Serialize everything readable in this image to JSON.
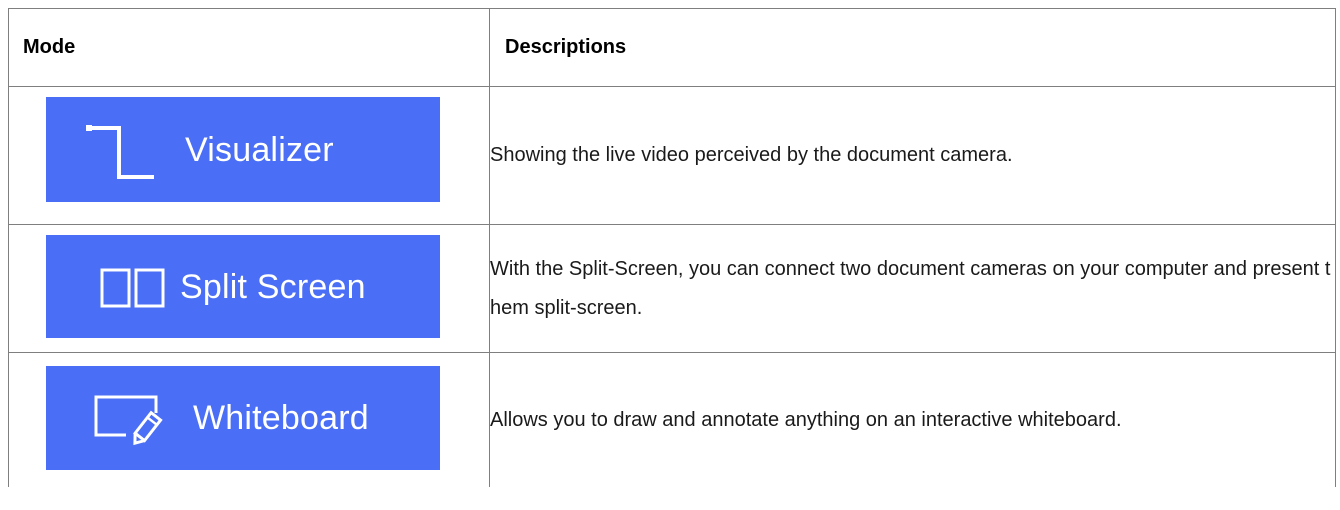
{
  "table": {
    "headers": {
      "mode": "Mode",
      "descriptions": "Descriptions"
    },
    "rows": [
      {
        "mode_label": "Visualizer",
        "icon": "document-camera-icon",
        "description": "Showing the live video perceived by the document camera."
      },
      {
        "mode_label": "Split Screen",
        "icon": "split-screen-icon",
        "description": "With the Split-Screen, you can connect two document cameras on your computer and present them split-screen."
      },
      {
        "mode_label": "Whiteboard",
        "icon": "whiteboard-pen-icon",
        "description": "Allows you to draw and annotate anything on an interactive whiteboard."
      }
    ]
  },
  "colors": {
    "button_background": "#4a6ef5",
    "button_text": "#ffffff",
    "border": "#7f7f7f"
  }
}
